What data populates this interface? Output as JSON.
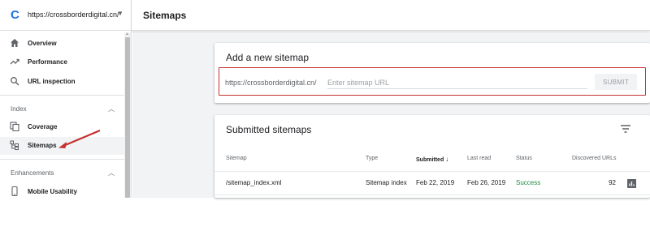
{
  "sidebar": {
    "property_url": "https://crossborderdigital.cn/",
    "items": [
      {
        "label": "Overview",
        "icon": "home-icon"
      },
      {
        "label": "Performance",
        "icon": "trending-up-icon"
      },
      {
        "label": "URL inspection",
        "icon": "search-icon"
      }
    ],
    "sections": [
      {
        "label": "Index",
        "items": [
          {
            "label": "Coverage",
            "icon": "file-copy-icon"
          },
          {
            "label": "Sitemaps",
            "icon": "sitemap-icon",
            "active": true
          }
        ]
      },
      {
        "label": "Enhancements",
        "items": [
          {
            "label": "Mobile Usability",
            "icon": "smartphone-icon"
          }
        ]
      }
    ]
  },
  "header": {
    "title": "Sitemaps"
  },
  "add_card": {
    "title": "Add a new sitemap",
    "url_prefix": "https://crossborderdigital.cn/",
    "input_value": "",
    "input_placeholder": "Enter sitemap URL",
    "submit_label": "SUBMIT"
  },
  "submitted_card": {
    "title": "Submitted sitemaps",
    "columns": [
      "Sitemap",
      "Type",
      "Submitted",
      "Last read",
      "Status",
      "Discovered URLs"
    ],
    "rows": [
      {
        "sitemap": "/sitemap_index.xml",
        "type": "Sitemap index",
        "submitted": "Feb 22, 2019",
        "last_read": "Feb 26, 2019",
        "status": "Success",
        "discovered_urls": "92"
      }
    ]
  },
  "colors": {
    "brand_blue": "#1a73e8",
    "annotation_red": "#c53030",
    "success_green": "#1e8e3e",
    "background_gray": "#f1f3f4"
  }
}
